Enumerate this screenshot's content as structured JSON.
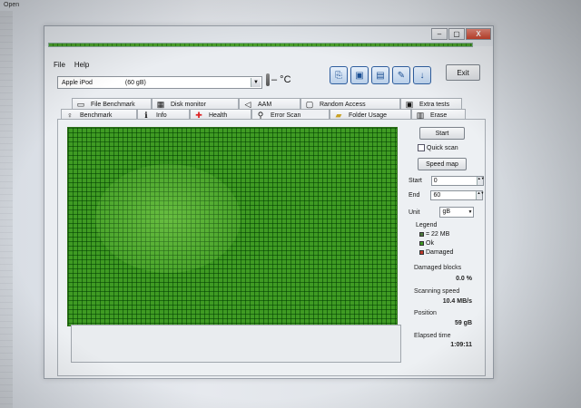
{
  "background": {
    "menu_fragment": "Open"
  },
  "window": {
    "progress_fraction": 1.0,
    "controls": {
      "minimize": "–",
      "restore": "▢",
      "close": "X"
    }
  },
  "menu": {
    "file": "File",
    "help": "Help"
  },
  "drive": {
    "name": "Apple  iPod",
    "size": "(60 gB)"
  },
  "temperature": {
    "value": "– °C"
  },
  "toolbar": {
    "buttons": [
      "copy-info-icon",
      "copy-screenshot-icon",
      "save-icon",
      "options-icon",
      "download-icon"
    ],
    "exit_label": "Exit"
  },
  "tabs": {
    "row1": [
      {
        "label": "File Benchmark",
        "icon": "file-benchmark-icon"
      },
      {
        "label": "Disk monitor",
        "icon": "disk-monitor-icon"
      },
      {
        "label": "AAM",
        "icon": "speaker-icon"
      },
      {
        "label": "Random Access",
        "icon": "random-access-icon"
      },
      {
        "label": "Extra tests",
        "icon": "extra-tests-icon"
      }
    ],
    "row2": [
      {
        "label": "Benchmark",
        "icon": "benchmark-icon"
      },
      {
        "label": "Info",
        "icon": "info-icon"
      },
      {
        "label": "Health",
        "icon": "health-cross-icon"
      },
      {
        "label": "Error Scan",
        "icon": "magnifier-icon"
      },
      {
        "label": "Folder Usage",
        "icon": "folder-icon"
      },
      {
        "label": "Erase",
        "icon": "trash-icon"
      }
    ]
  },
  "scan": {
    "start_button": "Start",
    "quick_scan_label": "Quick scan",
    "speed_map_button": "Speed map",
    "start_label": "Start",
    "start_value": "0",
    "end_label": "End",
    "end_value": "60",
    "unit_label": "Unit",
    "unit_value": "gB",
    "legend": {
      "title": "Legend",
      "block": "= 22 MB",
      "ok": "Ok",
      "damaged": "Damaged"
    },
    "damaged_label": "Damaged blocks",
    "damaged_value": "0.0 %",
    "speed_label": "Scanning speed",
    "speed_value": "10.4 MB/s",
    "position_label": "Position",
    "position_value": "59 gB",
    "elapsed_label": "Elapsed time",
    "elapsed_value": "1:09:11"
  },
  "colors": {
    "ok_block": "#3f9b23",
    "damaged_block": "#c0392b",
    "grid_line": "#1f5a12"
  }
}
